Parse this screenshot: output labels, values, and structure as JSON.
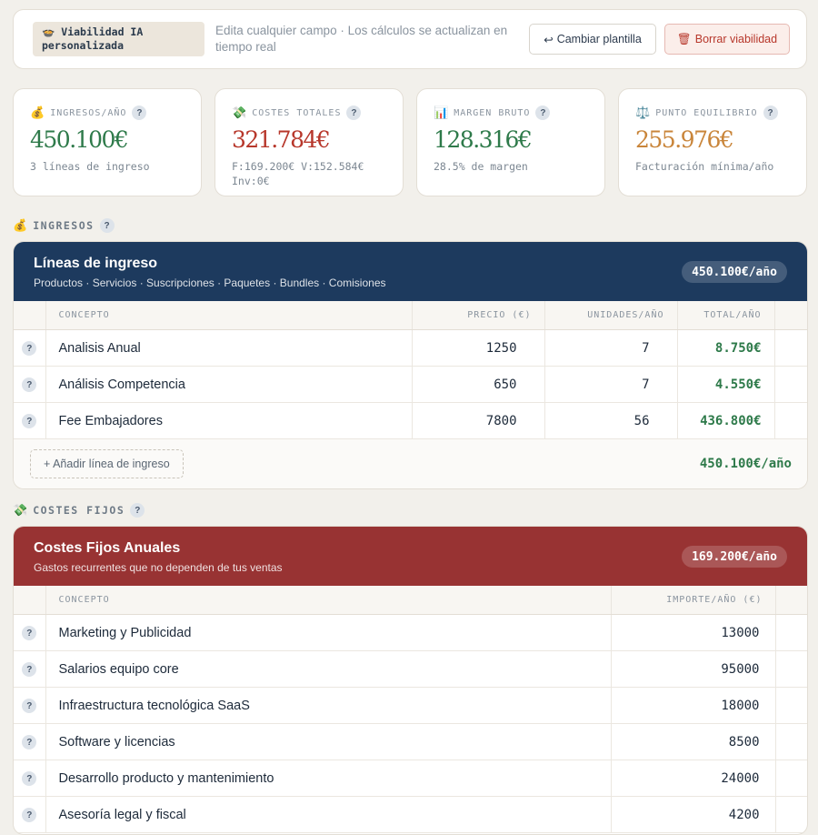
{
  "topbar": {
    "tag_icon": "🍲",
    "tag_label": "Viabilidad IA personalizada",
    "hint": "Edita cualquier campo · Los cálculos se actualizan en tiempo real",
    "change_template_label": "Cambiar plantilla",
    "delete_label": "Borrar viabilidad"
  },
  "metrics": [
    {
      "icon": "💰",
      "label": "INGRESOS/AÑO",
      "value": "450.100€",
      "sub": "3 líneas de ingreso",
      "color": "#2e7a4a"
    },
    {
      "icon": "💸",
      "label": "COSTES TOTALES",
      "value": "321.784€",
      "sub": "F:169.200€ V:152.584€ Inv:0€",
      "color": "#b7372b"
    },
    {
      "icon": "📊",
      "label": "MARGEN BRUTO",
      "value": "128.316€",
      "sub": "28.5% de margen",
      "color": "#2e7a4a"
    },
    {
      "icon": "⚖️",
      "label": "PUNTO EQUILIBRIO",
      "value": "255.976€",
      "sub": "Facturación mínima/año",
      "color": "#c9853a"
    }
  ],
  "income_section": {
    "icon": "💰",
    "heading": "INGRESOS",
    "title": "Líneas de ingreso",
    "subtitle": "Productos · Servicios · Suscripciones · Paquetes · Bundles · Comisiones",
    "total_pill": "450.100€/año",
    "columns": [
      "CONCEPTO",
      "PRECIO (€)",
      "UNIDADES/AÑO",
      "TOTAL/AÑO"
    ],
    "rows": [
      {
        "concept": "Analisis Anual",
        "price": "1250",
        "units": "7",
        "total": "8.750€"
      },
      {
        "concept": "Análisis Competencia",
        "price": "650",
        "units": "7",
        "total": "4.550€"
      },
      {
        "concept": "Fee Embajadores",
        "price": "7800",
        "units": "56",
        "total": "436.800€"
      }
    ],
    "add_label": "+ Añadir línea de ingreso",
    "footer_total": "450.100€/año"
  },
  "fixed_costs_section": {
    "icon": "💸",
    "heading": "COSTES FIJOS",
    "title": "Costes Fijos Anuales",
    "subtitle": "Gastos recurrentes que no dependen de tus ventas",
    "total_pill": "169.200€/año",
    "columns": [
      "CONCEPTO",
      "IMPORTE/AÑO (€)"
    ],
    "rows": [
      {
        "concept": "Marketing y Publicidad",
        "amount": "13000"
      },
      {
        "concept": "Salarios equipo core",
        "amount": "95000"
      },
      {
        "concept": "Infraestructura tecnológica SaaS",
        "amount": "18000"
      },
      {
        "concept": "Software y licencias",
        "amount": "8500"
      },
      {
        "concept": "Desarrollo producto y mantenimiento",
        "amount": "24000"
      },
      {
        "concept": "Asesoría legal y fiscal",
        "amount": "4200"
      }
    ]
  },
  "help_glyph": "?",
  "colors": {
    "navy": "#1d3a5e",
    "red": "#983333",
    "green": "#2e7a4a",
    "orange": "#c9853a"
  }
}
